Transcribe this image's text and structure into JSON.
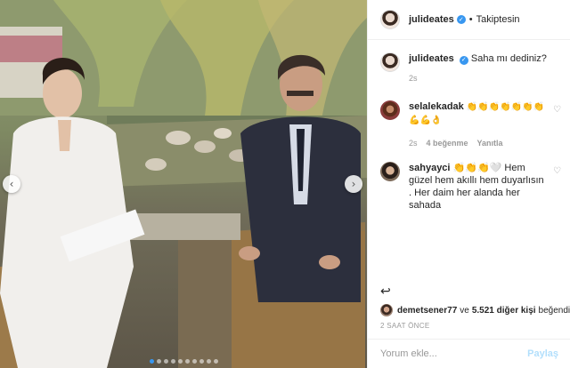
{
  "post": {
    "author": "julideates",
    "follow_separator": "•",
    "follow_status": "Takiptesin"
  },
  "comments": [
    {
      "user": "julideates",
      "text": "Saha mı dediniz?",
      "time": "2s",
      "verified": true
    },
    {
      "user": "selalekadak",
      "text": "👏👏👏👏👏👏👏💪💪👌",
      "time": "2s",
      "likes": "4 beğenme",
      "reply": "Yanıtla"
    },
    {
      "user": "sahyayci",
      "text": "👏👏👏🤍 Hem güzel hem akıllı hem duyarlısın . Her daim her alanda her sahada"
    }
  ],
  "likes": {
    "user": "demetsener77",
    "middle": "ve",
    "count": "5.521 diğer kişi",
    "suffix": "beğendi"
  },
  "timestamp": "2 SAAT ÖNCE",
  "comment_box": {
    "placeholder": "Yorum ekle...",
    "post_label": "Paylaş"
  },
  "carousel": {
    "dot_count": 10,
    "active_index": 0,
    "prev_glyph": "‹",
    "next_glyph": "›"
  },
  "icons": {
    "heart": "♡",
    "verified": "✓",
    "reply_arrow": "↩"
  },
  "colors": {
    "verified_blue": "#3897f0",
    "post_button_disabled": "#b2dffc",
    "meta_gray": "#999999"
  }
}
